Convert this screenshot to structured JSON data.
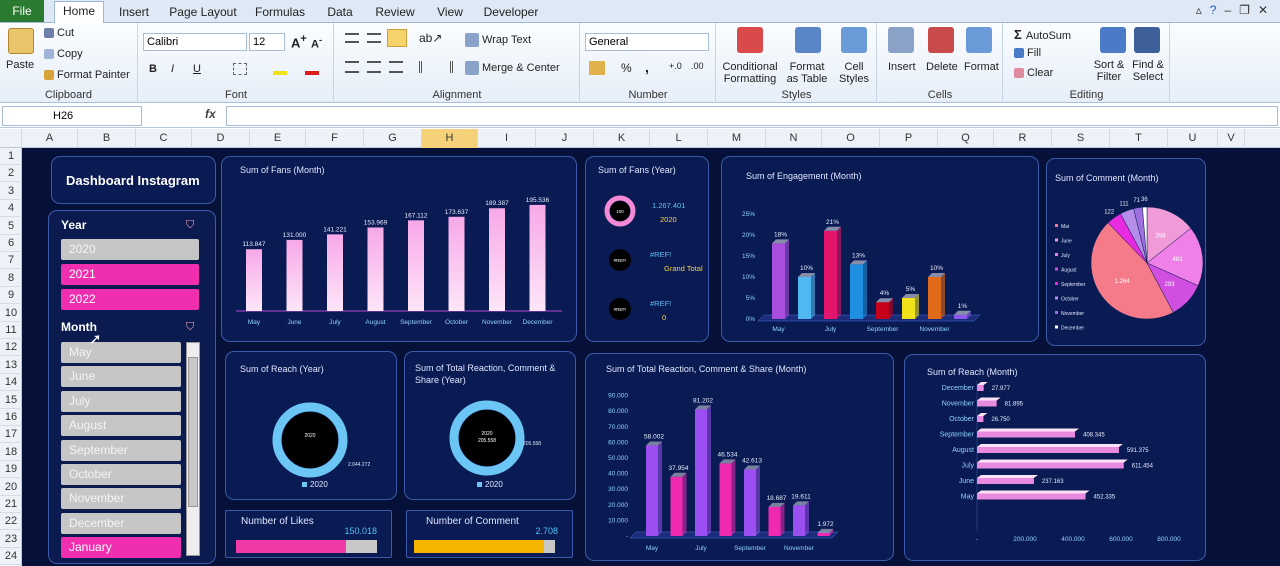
{
  "ribbon_tabs": {
    "file": "File",
    "items": [
      "Home",
      "Insert",
      "Page Layout",
      "Formulas",
      "Data",
      "Review",
      "View",
      "Developer"
    ]
  },
  "clipboard": {
    "paste": "Paste",
    "cut": "Cut",
    "copy": "Copy",
    "format_painter": "Format Painter",
    "label": "Clipboard"
  },
  "font": {
    "name": "Calibri",
    "size": "12",
    "label": "Font",
    "bold": "B",
    "italic": "I",
    "underline": "U"
  },
  "alignment": {
    "wrap_text": "Wrap Text",
    "merge_center": "Merge & Center",
    "label": "Alignment"
  },
  "number": {
    "format": "General",
    "percent": "%",
    "comma": ",",
    "label": "Number"
  },
  "styles": {
    "conditional": "Conditional Formatting",
    "format_table": "Format as Table",
    "cell_styles": "Cell Styles",
    "label": "Styles"
  },
  "cells": {
    "insert": "Insert",
    "delete": "Delete",
    "format": "Format",
    "label": "Cells"
  },
  "editing": {
    "autosum": "AutoSum",
    "fill": "Fill",
    "clear": "Clear",
    "sort_filter": "Sort & Filter",
    "find_select": "Find & Select",
    "label": "Editing"
  },
  "formula_bar": {
    "name_box": "H26",
    "fx": "fx",
    "formula": ""
  },
  "columns": [
    "A",
    "B",
    "C",
    "D",
    "E",
    "F",
    "G",
    "H",
    "I",
    "J",
    "K",
    "L",
    "M",
    "N",
    "O",
    "P",
    "Q",
    "R",
    "S",
    "T",
    "U",
    "V"
  ],
  "selected_column": "H",
  "rows": [
    "1",
    "2",
    "3",
    "4",
    "5",
    "6",
    "7",
    "8",
    "9",
    "10",
    "11",
    "12",
    "13",
    "14",
    "15",
    "16",
    "17",
    "18",
    "19",
    "20",
    "21",
    "22",
    "23",
    "24"
  ],
  "dashboard": {
    "title": "Dashboard Instagram",
    "year_slicer": {
      "header": "Year",
      "items": [
        {
          "label": "2020",
          "selected": false
        },
        {
          "label": "2021",
          "selected": true
        },
        {
          "label": "2022",
          "selected": true
        }
      ]
    },
    "month_slicer": {
      "header": "Month",
      "items": [
        {
          "label": "May",
          "selected": false
        },
        {
          "label": "June",
          "selected": false
        },
        {
          "label": "July",
          "selected": false
        },
        {
          "label": "August",
          "selected": false
        },
        {
          "label": "September",
          "selected": false
        },
        {
          "label": "October",
          "selected": false
        },
        {
          "label": "November",
          "selected": false
        },
        {
          "label": "December",
          "selected": false
        },
        {
          "label": "January",
          "selected": true
        }
      ]
    },
    "likes": {
      "label": "Number of Likes",
      "value_text": "150.018",
      "fill": 0.78
    },
    "comments": {
      "label": "Number of Comment",
      "value_text": "2.708",
      "fill": 0.92
    }
  },
  "chart_data": [
    {
      "id": "fans_month",
      "type": "bar",
      "title": "Sum of Fans (Month)",
      "categories": [
        "May",
        "June",
        "July",
        "August",
        "September",
        "October",
        "November",
        "December"
      ],
      "values": [
        113847,
        131000,
        141221,
        153969,
        167112,
        173637,
        189387,
        195536
      ],
      "labels": [
        "113.847",
        "131.000",
        "141.221",
        "153.969",
        "167.112",
        "173.637",
        "189.387",
        "195.536"
      ],
      "ylim": [
        0,
        230000
      ],
      "grid": false
    },
    {
      "id": "fans_year",
      "type": "donut",
      "title": "Sum of Fans (Year)",
      "rings": [
        {
          "center_label": "100",
          "value_text": "1.267.401",
          "sub_label": "2020"
        },
        {
          "center_label": "#REF!",
          "value_text": "#REF!",
          "sub_label": "Grand Total"
        },
        {
          "center_label": "#REF!",
          "value_text": "#REF!",
          "sub_label": "0"
        }
      ]
    },
    {
      "id": "engagement_month",
      "type": "bar",
      "title": "Sum of Engagement (Month)",
      "categories": [
        "May",
        "June",
        "July",
        "August",
        "September",
        "October",
        "November",
        "December"
      ],
      "axis_categories": [
        "May",
        "",
        "July",
        "",
        "September",
        "",
        "November",
        ""
      ],
      "values": [
        18,
        10,
        21,
        13,
        4,
        5,
        10,
        1
      ],
      "labels": [
        "18%",
        "10%",
        "21%",
        "13%",
        "4%",
        "5%",
        "10%",
        "1%"
      ],
      "colors": [
        "#a94fe0",
        "#4fb8f0",
        "#e3156d",
        "#1e8fe0",
        "#c6001a",
        "#f2e21a",
        "#e06a1a",
        "#8a57e8"
      ],
      "yticks": [
        "0%",
        "5%",
        "10%",
        "15%",
        "20%",
        "25%"
      ],
      "ylim": [
        0,
        25
      ],
      "grid": false
    },
    {
      "id": "comment_month",
      "type": "pie",
      "title": "Sum of Comment (Month)",
      "legend": [
        "Mai",
        "June",
        "July",
        "August",
        "September",
        "October",
        "November",
        "December"
      ],
      "values": [
        1264,
        398,
        481,
        293,
        122,
        111,
        71,
        36
      ],
      "labels": [
        "1.264",
        "398",
        "481",
        "293",
        "122",
        "111",
        "71",
        "36"
      ],
      "colors": [
        "#f57a8a",
        "#f09ad8",
        "#ee80e8",
        "#d14fe0",
        "#e82ae0",
        "#b48ee8",
        "#9f6fe0",
        "#ffffff"
      ]
    },
    {
      "id": "reach_year",
      "type": "donut",
      "title": "Sum of Reach (Year)",
      "center_label": "2020",
      "legend": "2020",
      "value_text": "2.044.272"
    },
    {
      "id": "trcs_year",
      "type": "donut",
      "title": "Sum of Total Reaction, Comment & Share (Year)",
      "center_label": "2020",
      "center_value": "205.558",
      "side_value": "205.558",
      "legend": "2020"
    },
    {
      "id": "trcs_month",
      "type": "bar",
      "title": "Sum of Total Reaction, Comment & Share (Month)",
      "categories": [
        "May",
        "June",
        "July",
        "August",
        "September",
        "October",
        "November",
        "December"
      ],
      "axis_categories": [
        "May",
        "",
        "July",
        "",
        "September",
        "",
        "November",
        ""
      ],
      "values": [
        58002,
        37954,
        81202,
        46534,
        42613,
        18687,
        19611,
        1972
      ],
      "labels": [
        "58.002",
        "37.954",
        "81.202",
        "46.534",
        "42.613",
        "18.687",
        "19.611",
        "1.972"
      ],
      "colors": [
        "#9b4ff0",
        "#f02ab0",
        "#9b4ff0",
        "#f02ab0",
        "#9b4ff0",
        "#f02ab0",
        "#9b4ff0",
        "#f02ab0"
      ],
      "yticks": [
        "-",
        "10.000",
        "20.000",
        "30.000",
        "40.000",
        "50.000",
        "60.000",
        "70.000",
        "80.000",
        "90.000"
      ],
      "ylim": [
        0,
        90000
      ],
      "grid": false
    },
    {
      "id": "reach_month",
      "type": "bar",
      "title": "Sum of Reach (Month)",
      "orientation": "horizontal",
      "categories": [
        "December",
        "November",
        "October",
        "September",
        "August",
        "July",
        "June",
        "May"
      ],
      "values": [
        27977,
        81895,
        26750,
        408345,
        591375,
        611454,
        237163,
        452335
      ],
      "labels": [
        "27.977",
        "81.895",
        "26.750",
        "408.345",
        "591.375",
        "611.454",
        "237.163",
        "452.335"
      ],
      "xticks": [
        "-",
        "200.000",
        "400.000",
        "600.000",
        "800.000"
      ],
      "xlim": [
        0,
        800000
      ],
      "grid": false
    }
  ]
}
